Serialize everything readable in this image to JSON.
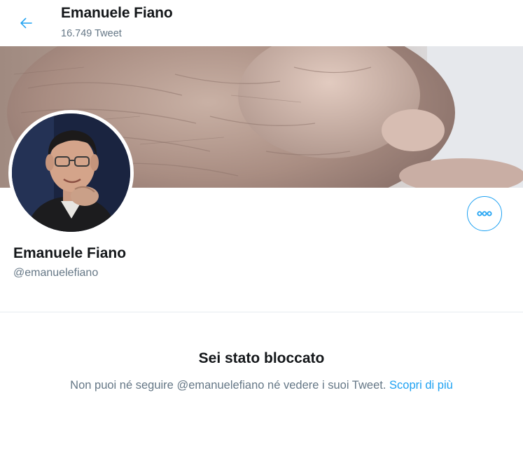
{
  "header": {
    "title": "Emanuele Fiano",
    "tweet_count": "16.749 Tweet",
    "back_icon": "arrow-left-icon"
  },
  "profile": {
    "name": "Emanuele Fiano",
    "handle": "@emanuelefiano",
    "more_icon": "more-horizontal-icon"
  },
  "blocked": {
    "title": "Sei stato bloccato",
    "message": "Non puoi né seguire @emanuelefiano né vedere i suoi Tweet.",
    "link": "Scopri di più"
  },
  "colors": {
    "accent": "#1da1f2",
    "text_primary": "#14171a",
    "text_secondary": "#657786",
    "divider": "#e6ecf0"
  }
}
